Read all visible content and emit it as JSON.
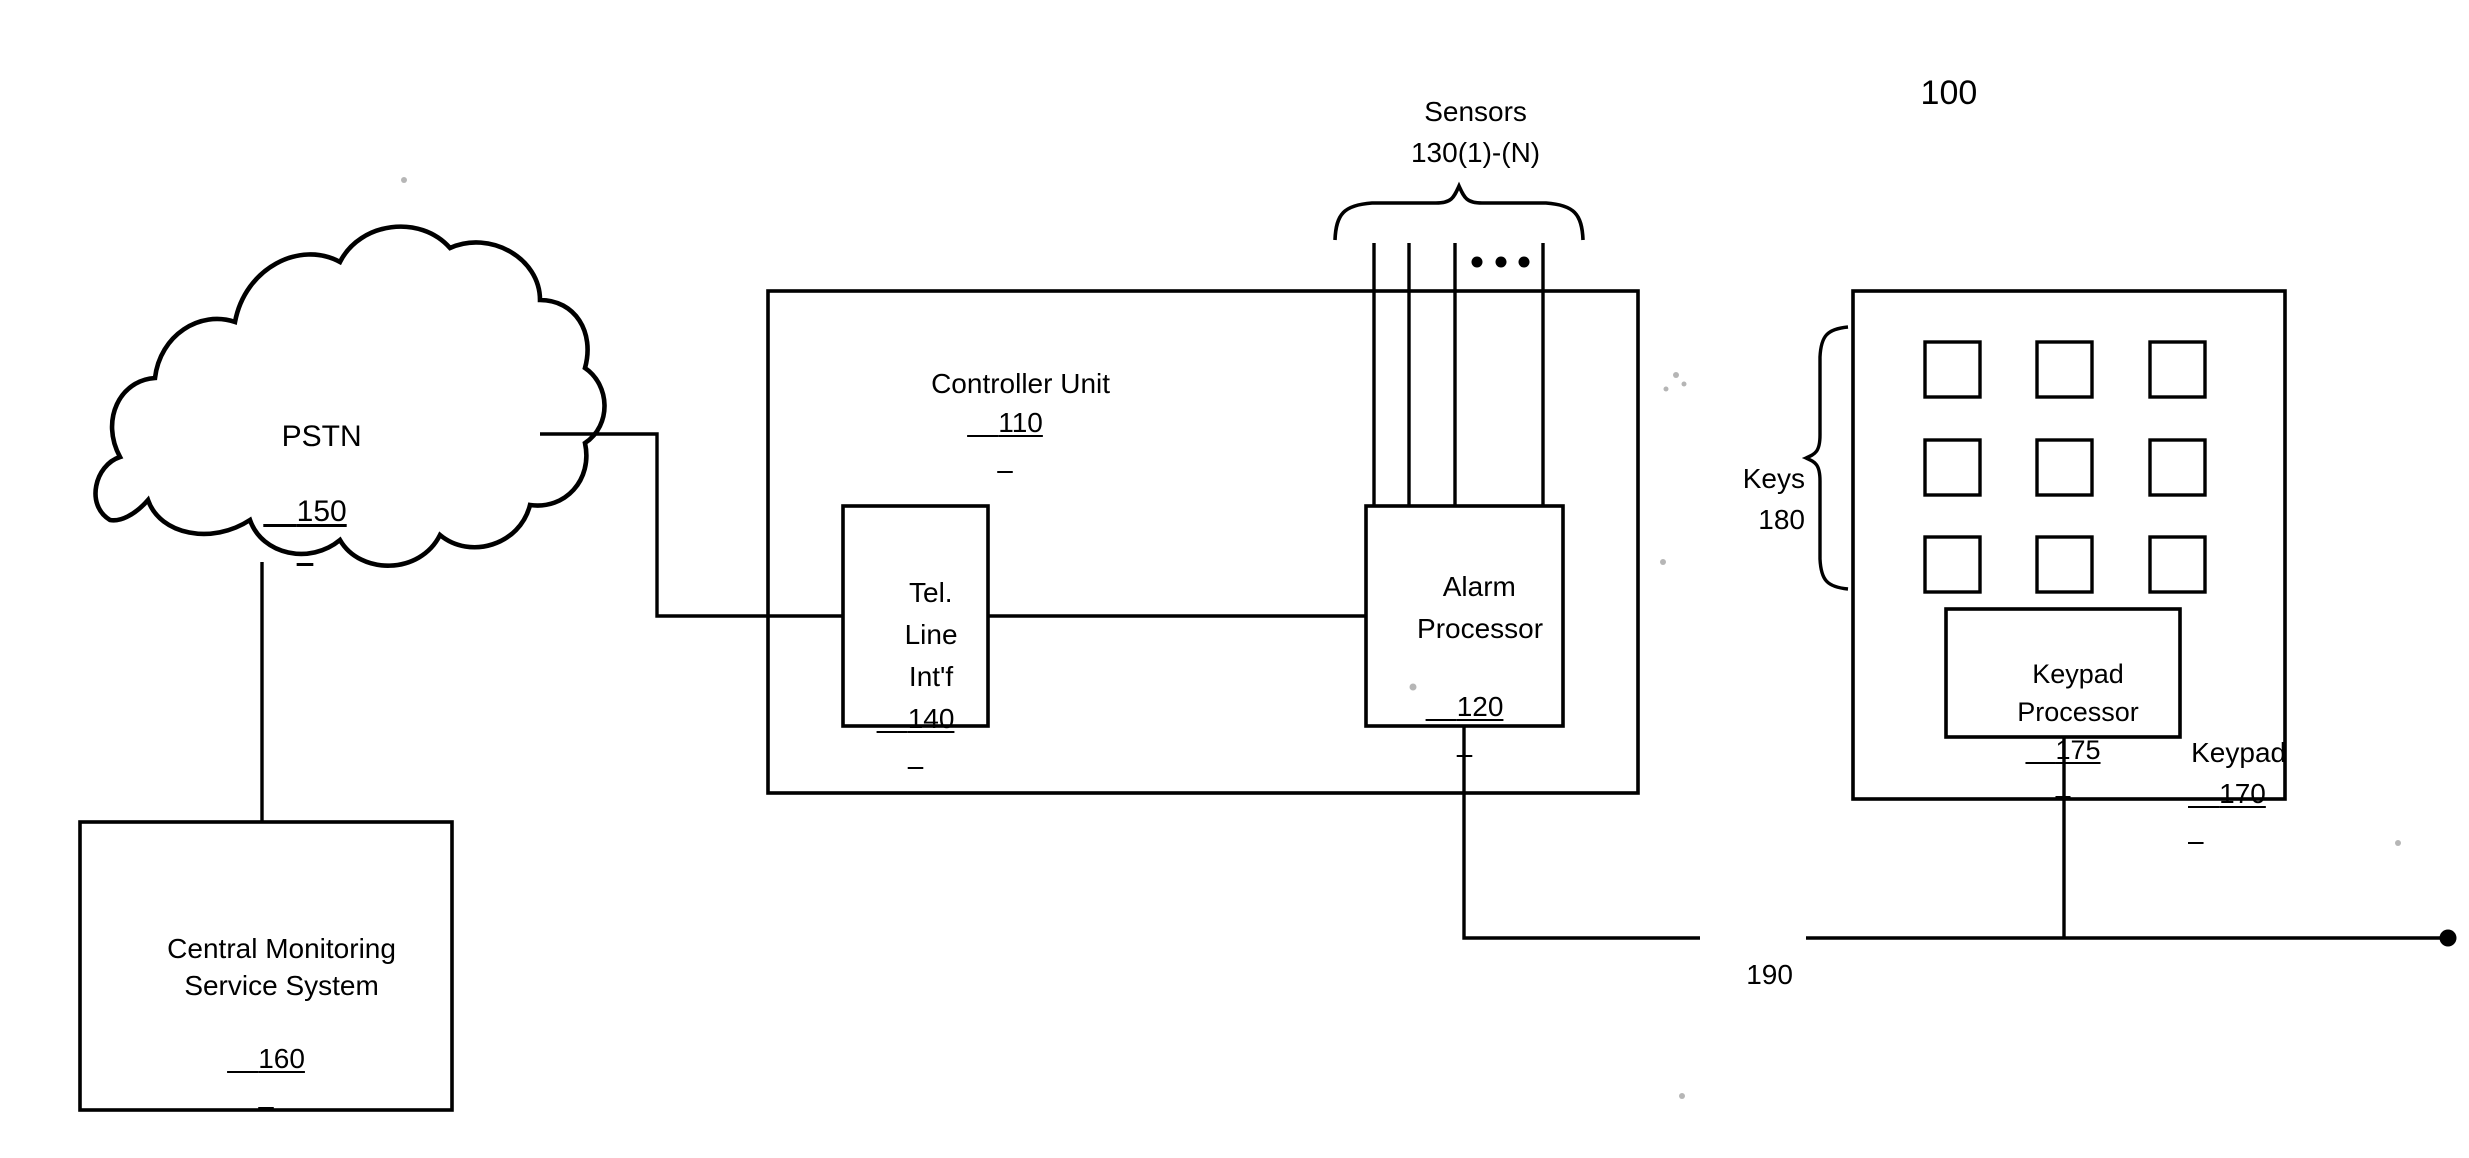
{
  "figure": {
    "overall_ref": "100",
    "bus_ref": "190"
  },
  "pstn": {
    "name": "PSTN",
    "ref": "150"
  },
  "central_monitoring": {
    "line1": "Central Monitoring",
    "line2": "Service System",
    "ref": "160"
  },
  "controller": {
    "name": "Controller Unit",
    "ref": "110"
  },
  "tel_line_interface": {
    "line1": "Tel.",
    "line2": "Line",
    "line3": "Int'f",
    "ref": "140"
  },
  "alarm_processor": {
    "line1": "Alarm",
    "line2": "Processor",
    "ref": "120"
  },
  "sensors": {
    "name": "Sensors",
    "ref": "130(1)-(N)",
    "ellipsis": "•   •   •",
    "count_lines": 4
  },
  "keypad": {
    "name": "Keypad",
    "ref": "170"
  },
  "keypad_processor": {
    "line1": "Keypad",
    "line2": "Processor",
    "ref": "175"
  },
  "keys": {
    "name": "Keys",
    "ref": "180",
    "rows": 3,
    "cols": 3
  },
  "colors": {
    "stroke": "#000000",
    "background": "#ffffff"
  }
}
